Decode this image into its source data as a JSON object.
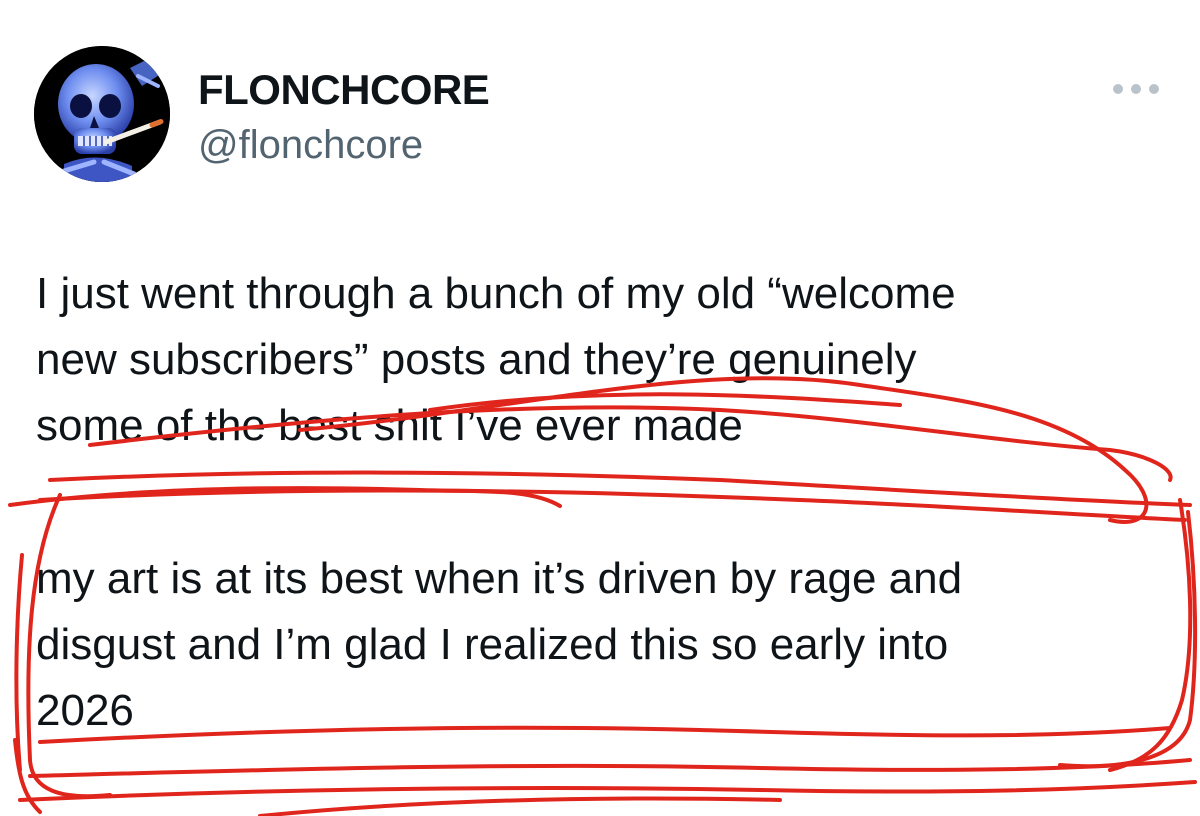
{
  "user": {
    "display_name": "FLONCHCORE",
    "handle": "@flonchcore",
    "avatar_icon": "skeleton-smoking-avatar"
  },
  "more_icon": "more-horizontal-icon",
  "tweet": {
    "paragraph1": [
      "I just went through a bunch of my old “welcome",
      "new subscribers” posts and they’re genuinely",
      "some of the best shit I’ve ever made"
    ],
    "paragraph2": [
      "my art is at its best when it’s driven by rage and",
      "disgust and I’m glad I realized this so early into",
      "2026"
    ]
  },
  "colors": {
    "text": "#0f1419",
    "secondary": "#536471",
    "scribble": "#e0261c",
    "more_dots": "#b9c3cc"
  }
}
